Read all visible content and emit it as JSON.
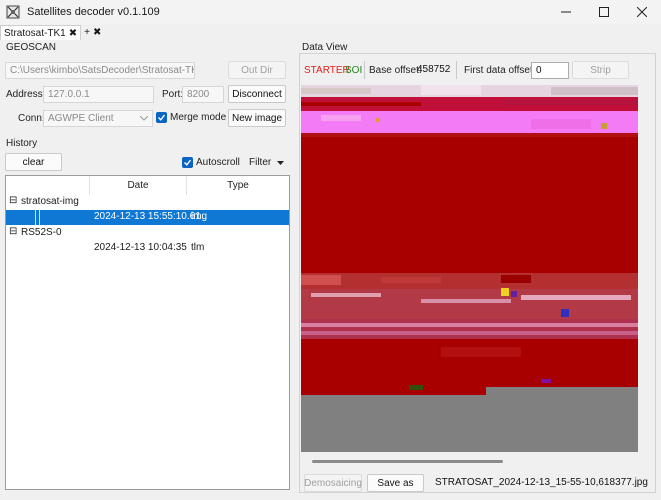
{
  "window": {
    "title": "Satellites decoder v0.1.109",
    "minimize": "—",
    "maximize": "☐",
    "close": "✕"
  },
  "tabs": [
    {
      "label": "Stratosat-TK1",
      "active": true
    },
    {
      "label": "+",
      "active": false
    }
  ],
  "geoscan": {
    "group_label": "GEOSCAN",
    "path_value": "C:\\Users\\kimbo\\SatsDecoder\\Stratosat-TK1",
    "out_dir_label": "Out Dir",
    "address_label": "Address:",
    "address_value": "127.0.0.1",
    "port_label": "Port:",
    "port_value": "8200",
    "disconnect_label": "Disconnect",
    "conn_label": "Conn:",
    "conn_value": "AGWPE Client",
    "merge_mode_label": "Merge mode",
    "merge_mode_checked": true,
    "new_image_label": "New image"
  },
  "history": {
    "group_label": "History",
    "clear_label": "clear",
    "autoscroll_label": "Autoscroll",
    "autoscroll_checked": true,
    "filter_label": "Filter",
    "columns": [
      "Date",
      "Type"
    ],
    "groups": [
      {
        "name": "stratosat-img",
        "rows": [
          {
            "date": "2024-12-13 15:55:10.61",
            "type": "img",
            "selected": true
          }
        ]
      },
      {
        "name": "RS52S-0",
        "rows": [
          {
            "date": "2024-12-13 10:04:35",
            "type": "tlm",
            "selected": false
          }
        ]
      }
    ]
  },
  "dataview": {
    "group_label": "Data View",
    "starter_label": "STARTER",
    "soi_label": "SOI",
    "base_offset_label": "Base offset:",
    "base_offset_value": "458752",
    "first_data_offset_label": "First data offset:",
    "first_data_offset_value": "0",
    "strip_label": "Strip",
    "demosaicing_label": "Demosaicing",
    "save_as_label": "Save as",
    "filename": "STRATOSAT_2024-12-13_15-55-10,618377.jpg"
  },
  "colors": {
    "starter": "#e0201c",
    "soi": "#1f8a1f",
    "selection": "#0f78d4",
    "checkbox": "#0a64c2",
    "image_red": "#a80000",
    "image_magenta": "#f37bf5",
    "image_gray": "#808080"
  }
}
